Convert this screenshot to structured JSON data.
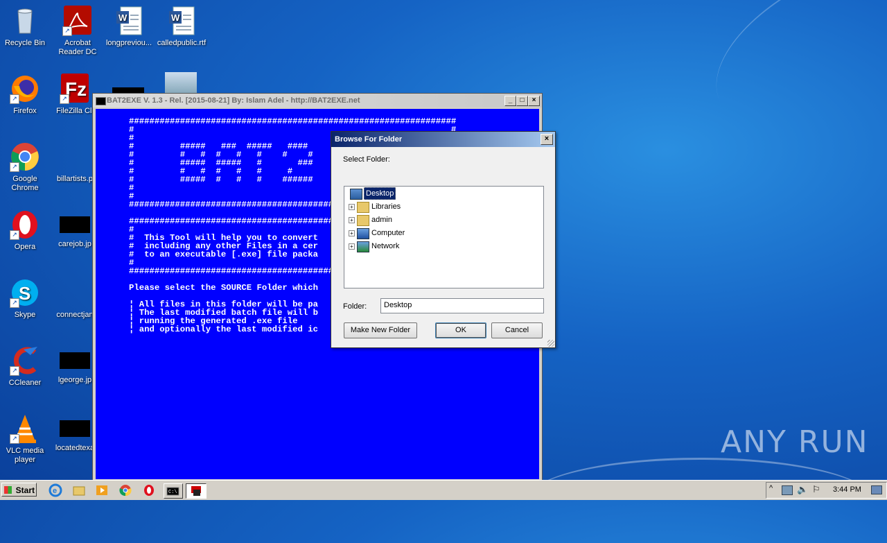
{
  "desktop": {
    "icons": [
      {
        "label": "Recycle Bin"
      },
      {
        "label": "Acrobat Reader DC"
      },
      {
        "label": "longpreviou..."
      },
      {
        "label": "calledpublic.rtf"
      },
      {
        "label": "Firefox"
      },
      {
        "label": "FileZilla Cli"
      },
      {
        "label": "Google Chrome"
      },
      {
        "label": "billartists.p"
      },
      {
        "label": "Opera"
      },
      {
        "label": "carejob.jp"
      },
      {
        "label": "Skype"
      },
      {
        "label": "connectjan"
      },
      {
        "label": "CCleaner"
      },
      {
        "label": "lgeorge.jp"
      },
      {
        "label": "VLC media player"
      },
      {
        "label": "locatedtexa"
      }
    ],
    "watermark": "ANY RUN"
  },
  "console": {
    "title": "BAT2EXE V. 1.3 - Rel. [2015-08-21] By: Islam Adel - http://BAT2EXE.net",
    "lines": [
      "################################################################",
      "#                                                              #",
      "#                                                              #",
      "#         #####   ###  #####   ####                            #",
      "#         #   #  #   #   #    #    #                           #",
      "#         #####  #####   #       ###                           #",
      "#         #   #  #   #   #     #                               #",
      "#         #####  #   #   #    ######                           #",
      "#                                                              #",
      "#                                                              #",
      "################################################################",
      "",
      "################################################################",
      "#",
      "#  This Tool will help you to convert",
      "#  including any other Files in a cer",
      "#  to an executable [.exe] file packa",
      "#",
      "################################################################",
      "",
      "Please select the SOURCE Folder which",
      "",
      "¦ All files in this folder will be pa",
      "¦ The last modified batch file will b",
      "¦ running the generated .exe file",
      "¦ and optionally the last modified ic"
    ]
  },
  "dialog": {
    "title": "Browse For Folder",
    "prompt": "Select Folder:",
    "tree": [
      {
        "label": "Desktop",
        "selected": true
      },
      {
        "label": "Libraries"
      },
      {
        "label": "admin"
      },
      {
        "label": "Computer"
      },
      {
        "label": "Network"
      }
    ],
    "folder_label": "Folder:",
    "folder_value": "Desktop",
    "make_new_folder": "Make New Folder",
    "ok": "OK",
    "cancel": "Cancel"
  },
  "taskbar": {
    "start": "Start",
    "clock": "3:44 PM"
  }
}
